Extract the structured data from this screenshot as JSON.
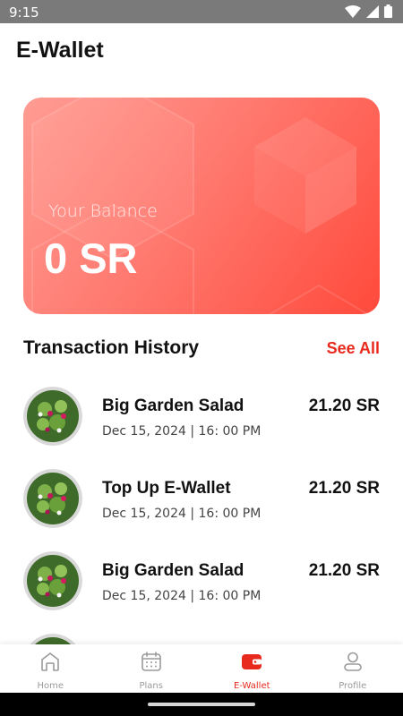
{
  "status_bar": {
    "time": "9:15"
  },
  "header": {
    "title": "E-Wallet"
  },
  "balance_card": {
    "label": "Your Balance",
    "value": "0 SR"
  },
  "transactions": {
    "title": "Transaction History",
    "see_all": "See All",
    "items": [
      {
        "name": "Big Garden Salad",
        "date": "Dec 15, 2024 | 16: 00 PM",
        "amount": "21.20 SR"
      },
      {
        "name": "Top Up E-Wallet",
        "date": "Dec 15, 2024 | 16: 00 PM",
        "amount": "21.20 SR"
      },
      {
        "name": "Big Garden Salad",
        "date": "Dec 15, 2024 | 16: 00 PM",
        "amount": "21.20 SR"
      }
    ]
  },
  "bottom_nav": {
    "items": [
      {
        "label": "Home",
        "icon": "home-icon"
      },
      {
        "label": "Plans",
        "icon": "calendar-icon"
      },
      {
        "label": "E-Wallet",
        "icon": "wallet-icon",
        "active": true
      },
      {
        "label": "Profile",
        "icon": "profile-icon"
      }
    ]
  },
  "colors": {
    "accent": "#e82a1e",
    "card_start": "#ff9c93",
    "card_end": "#ff4a3c"
  }
}
